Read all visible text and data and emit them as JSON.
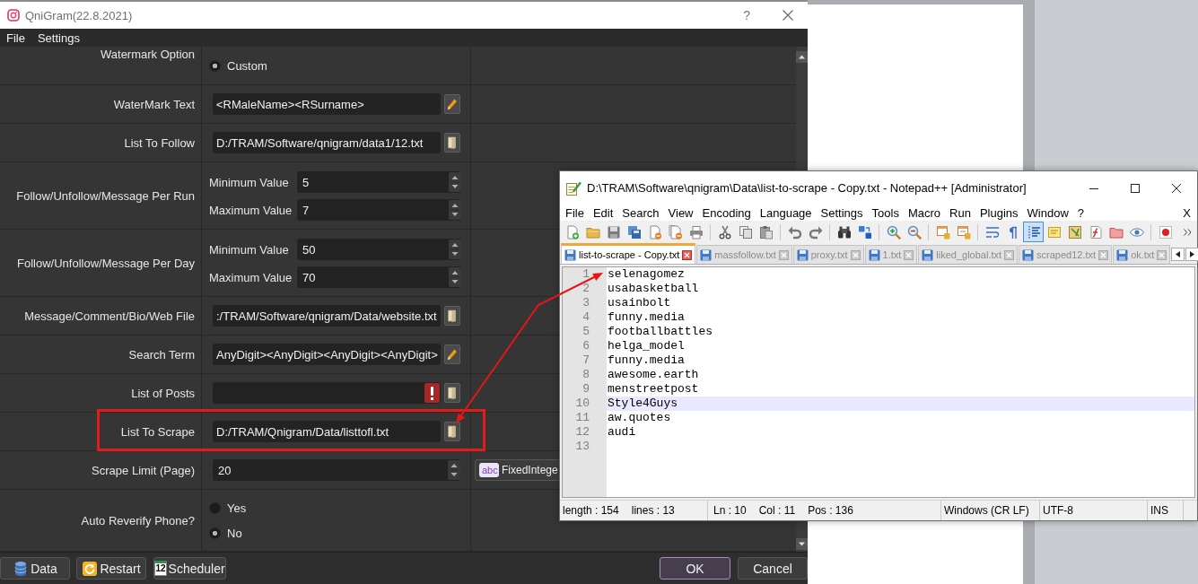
{
  "qnigram": {
    "title": "QniGram(22.8.2021)",
    "help": "?",
    "menu": [
      "File",
      "Settings"
    ],
    "rows": [
      {
        "kind": "radio",
        "label": "Watermark Option",
        "annotated": false,
        "options": [
          {
            "label": "Custom",
            "selected": true
          }
        ]
      },
      {
        "kind": "edit",
        "label": "WaterMark Text",
        "value": "<RMaleName><RSurname>",
        "invalid": false,
        "annotated": false
      },
      {
        "kind": "file",
        "label": "List To Follow",
        "value": "D:/TRAM/Software/qnigram/data1/12.txt",
        "invalid": false,
        "annotated": false
      },
      {
        "kind": "range",
        "label": "Follow/Unfollow/Message Per Run",
        "annotated": false,
        "fields": [
          {
            "label": "Minimum Value",
            "value": "5"
          },
          {
            "label": "Maximum Value",
            "value": "7"
          }
        ]
      },
      {
        "kind": "range",
        "label": "Follow/Unfollow/Message Per Day",
        "annotated": false,
        "fields": [
          {
            "label": "Minimum Value",
            "value": "50"
          },
          {
            "label": "Maximum Value",
            "value": "70"
          }
        ]
      },
      {
        "kind": "file",
        "label": "Message/Comment/Bio/Web File",
        "value": ":/TRAM/Software/qnigram/Data/website.txt",
        "invalid": false,
        "annotated": false
      },
      {
        "kind": "edit",
        "label": "Search Term",
        "value": "AnyDigit><AnyDigit><AnyDigit><AnyDigit>",
        "invalid": false,
        "annotated": false
      },
      {
        "kind": "file",
        "label": "List of Posts",
        "invalid": true,
        "annotated": false
      },
      {
        "kind": "file",
        "label": "List To Scrape",
        "value": "D:/TRAM/Qnigram/Data/listtofl.txt",
        "invalid": false,
        "annotated": true
      },
      {
        "kind": "spin",
        "label": "Scrape Limit (Page)",
        "value": "20",
        "annotated": false,
        "mode": {
          "icon_text": "abc",
          "label": "FixedIntege"
        }
      },
      {
        "kind": "radio",
        "label": "Auto Reverify Phone?",
        "annotated": false,
        "options": [
          {
            "label": "Yes",
            "selected": false
          },
          {
            "label": "No",
            "selected": true
          }
        ]
      }
    ],
    "buttons": [
      {
        "kind": "data",
        "label": "Data"
      },
      {
        "kind": "restart",
        "label": "Restart"
      },
      {
        "kind": "scheduler",
        "label": "Scheduler",
        "icon_text": "12"
      }
    ],
    "dialog_buttons": [
      {
        "label": "OK",
        "focused": true
      },
      {
        "label": "Cancel",
        "focused": false
      }
    ]
  },
  "notepad": {
    "title": "D:\\TRAM\\Software\\qnigram\\Data\\list-to-scrape - Copy.txt - Notepad++ [Administrator]",
    "menu": [
      "File",
      "Edit",
      "Search",
      "View",
      "Encoding",
      "Language",
      "Settings",
      "Tools",
      "Macro",
      "Run",
      "Plugins",
      "Window",
      "?"
    ],
    "close_document": "X",
    "toolbar": [
      {
        "on": false
      },
      {
        "on": false
      },
      {
        "on": false
      },
      {
        "on": false
      },
      {
        "on": false
      },
      {
        "on": false
      },
      {
        "on": false
      },
      {
        "on": false
      },
      {
        "on": false
      },
      {
        "on": false
      },
      {
        "on": false
      },
      {
        "on": false
      },
      {
        "on": false
      },
      {
        "on": false
      },
      {
        "on": false
      },
      {
        "on": false
      },
      {
        "on": false
      },
      {
        "on": false
      },
      {
        "on": false
      },
      {
        "on": false
      },
      {
        "on": true
      },
      {
        "on": false
      },
      {
        "on": false
      },
      {
        "on": false
      },
      {
        "on": false
      },
      {
        "on": false
      },
      {
        "on": false
      }
    ],
    "tabs": [
      {
        "label": "list-to-scrape - Copy.txt",
        "selected": true
      },
      {
        "label": "massfollow.txt",
        "selected": false
      },
      {
        "label": "proxy.txt",
        "selected": false
      },
      {
        "label": "1.txt",
        "selected": false
      },
      {
        "label": "liked_global.txt",
        "selected": false
      },
      {
        "label": "scraped12.txt",
        "selected": false
      },
      {
        "label": "ok.txt",
        "selected": false
      }
    ],
    "lines": [
      {
        "number": "1",
        "text": "selenagomez",
        "current": false
      },
      {
        "number": "2",
        "text": "usabasketball",
        "current": false
      },
      {
        "number": "3",
        "text": "usainbolt",
        "current": false
      },
      {
        "number": "4",
        "text": "funny.media",
        "current": false
      },
      {
        "number": "5",
        "text": "footballbattles",
        "current": false
      },
      {
        "number": "6",
        "text": "helga_model",
        "current": false
      },
      {
        "number": "7",
        "text": "funny.media",
        "current": false
      },
      {
        "number": "8",
        "text": "awesome.earth",
        "current": false
      },
      {
        "number": "9",
        "text": "menstreetpost",
        "current": false
      },
      {
        "number": "10",
        "text": "Style4Guys",
        "current": true
      },
      {
        "number": "11",
        "text": "aw.quotes",
        "current": false
      },
      {
        "number": "12",
        "text": "audi",
        "current": false
      },
      {
        "number": "13",
        "current": false
      }
    ],
    "status": [
      [
        "length : 154",
        "lines : 13"
      ],
      [
        "Ln : 10",
        "Col : 11",
        "Pos : 136"
      ],
      [
        "Windows (CR LF)"
      ],
      [
        "UTF-8"
      ],
      [
        "INS"
      ]
    ]
  }
}
